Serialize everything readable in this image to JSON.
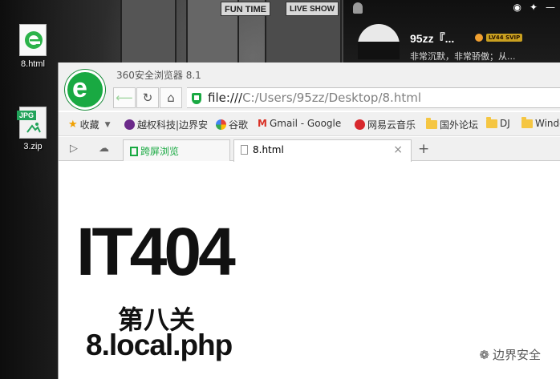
{
  "desktop": {
    "icons": [
      {
        "label": "8.html"
      },
      {
        "label": "3.zip",
        "badge": "JPG"
      }
    ],
    "wallpaper_signs": [
      "FUN TIME",
      "LIVE SHOW"
    ]
  },
  "qq": {
    "name": "95zz『...",
    "vip_badge": "LV44 SVIP",
    "signature": "非常沉默，非常骄傲；从..."
  },
  "browser": {
    "title": "360安全浏览器 8.1",
    "logo_letter": "e",
    "url_scheme": "file:///",
    "url_path": "C:/Users/95zz/Desktop/8.html",
    "bookmarks": [
      {
        "label": "收藏",
        "icon": "star-icon"
      },
      {
        "label": "越权科技|边界安",
        "icon": "site-icon"
      },
      {
        "label": "谷歌",
        "icon": "google-icon"
      },
      {
        "label": "Gmail - Google",
        "icon": "gmail-icon"
      },
      {
        "label": "网易云音乐",
        "icon": "netease-music-icon"
      },
      {
        "label": "国外论坛",
        "icon": "folder-icon"
      },
      {
        "label": "DJ",
        "icon": "folder-icon"
      },
      {
        "label": "Windo",
        "icon": "folder-icon"
      }
    ],
    "tabs": [
      {
        "label": "跨屏浏览",
        "active": false
      },
      {
        "label": "8.html",
        "active": true
      }
    ]
  },
  "page": {
    "heading": "IT404",
    "level": "第八关",
    "hint": "8.local.php"
  },
  "watermark": {
    "text": "边界安全"
  },
  "colors": {
    "accent_green": "#19a942",
    "text": "#111111"
  }
}
